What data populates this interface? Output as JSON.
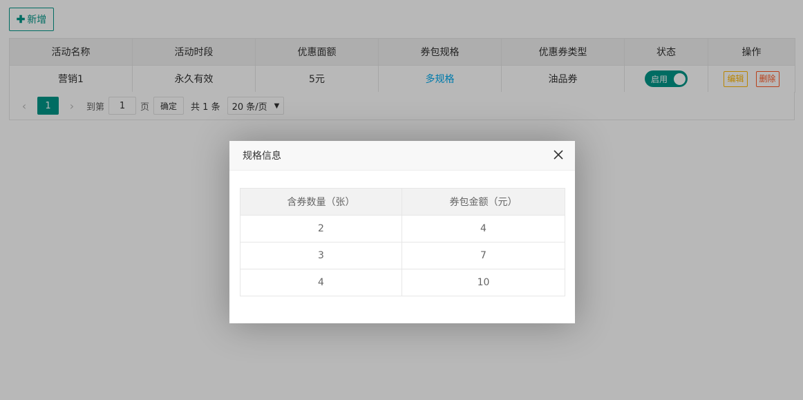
{
  "toolbar": {
    "add_label": "新增"
  },
  "grid": {
    "headers": [
      "活动名称",
      "活动时段",
      "优惠面额",
      "券包规格",
      "优惠券类型",
      "状态",
      "操作"
    ],
    "rows": [
      {
        "name": "营销1",
        "period": "永久有效",
        "amount": "5元",
        "spec_link": "多规格",
        "coupon_type": "油品券",
        "status_label": "启用",
        "enabled": true,
        "edit_label": "编辑",
        "delete_label": "删除"
      }
    ]
  },
  "pagination": {
    "current_page": "1",
    "goto_prefix": "到第",
    "goto_value": "1",
    "goto_suffix": "页",
    "confirm_label": "确定",
    "total_text": "共 1 条",
    "page_size_label": "20 条/页"
  },
  "dialog": {
    "title": "规格信息",
    "headers": [
      "含券数量（张）",
      "券包金额（元）"
    ],
    "rows": [
      [
        "2",
        "4"
      ],
      [
        "3",
        "7"
      ],
      [
        "4",
        "10"
      ]
    ]
  },
  "colors": {
    "primary": "#009688",
    "link": "#01aaed",
    "warn": "#ffb800",
    "danger": "#ff5722"
  }
}
